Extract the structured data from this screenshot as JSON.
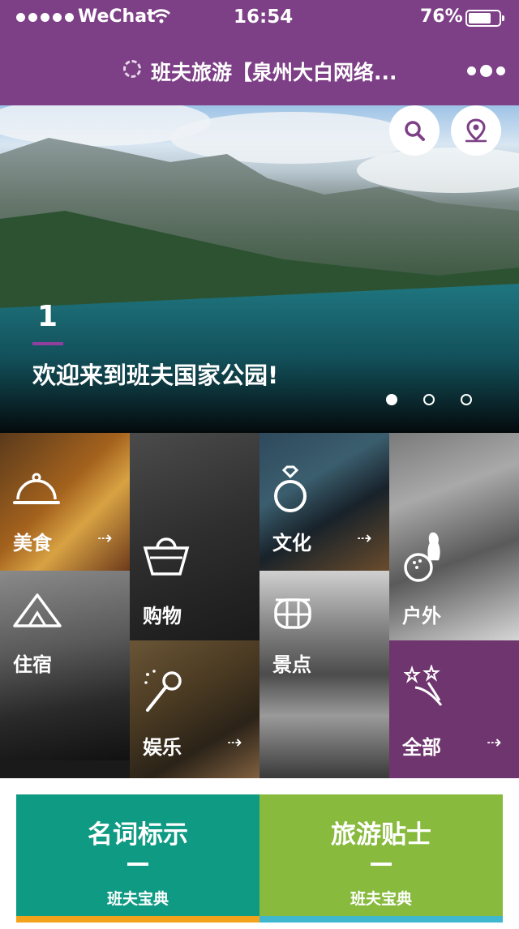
{
  "status_bar": {
    "carrier": "WeChat",
    "time": "16:54",
    "battery_percent": "76%",
    "battery_level": 0.76
  },
  "nav": {
    "title": "班夫旅游【泉州大白网络..."
  },
  "banner": {
    "index": "1",
    "caption": "欢迎来到班夫国家公园!",
    "slides_total": 3,
    "active_slide": 1
  },
  "categories": {
    "food": "美食",
    "shopping": "购物",
    "culture": "文化",
    "outdoor": "户外",
    "lodging": "住宿",
    "sights": "景点",
    "entertainment": "娱乐",
    "all": "全部"
  },
  "cards": [
    {
      "title": "名词标示",
      "subtitle": "班夫宝典"
    },
    {
      "title": "旅游贴士",
      "subtitle": "班夫宝典"
    }
  ],
  "colors": {
    "brand_purple": "#7d3f86",
    "card_teal": "#0f9a83",
    "card_green": "#87ba3d",
    "stripe_orange": "#f3a31b",
    "stripe_cyan": "#3fb7cf"
  }
}
